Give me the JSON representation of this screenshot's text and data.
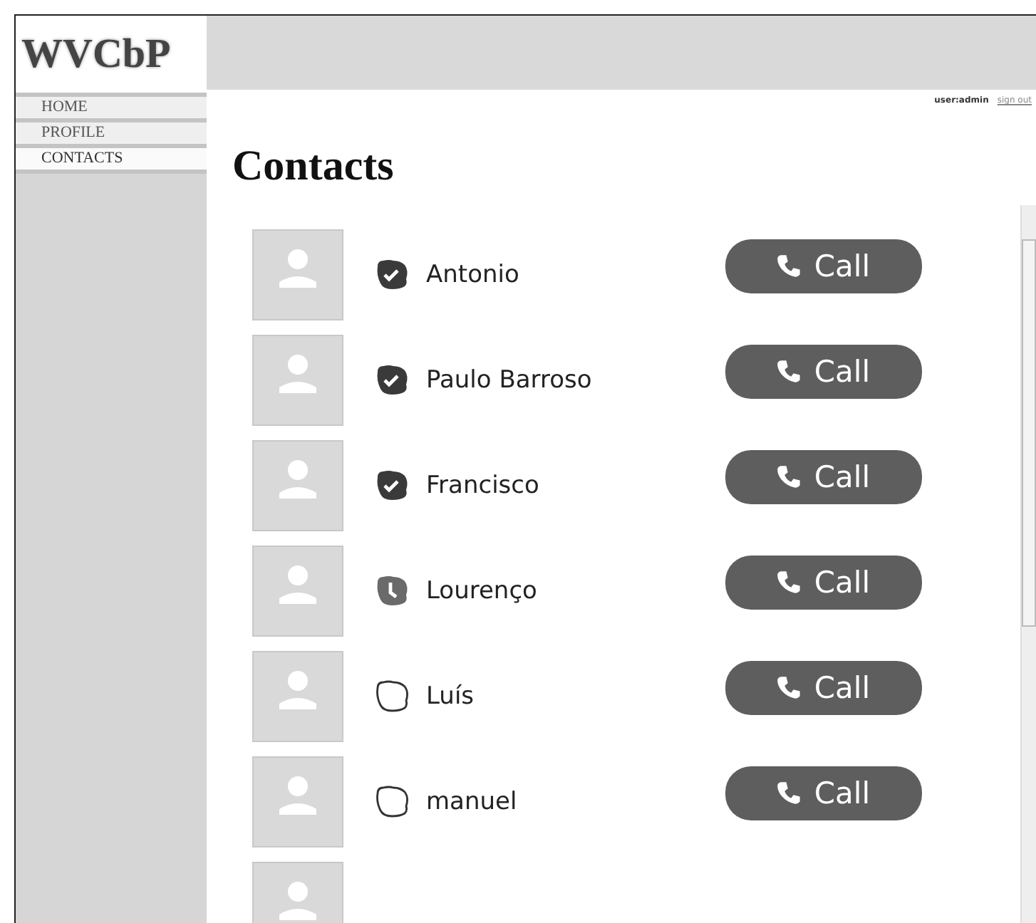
{
  "logo": "WVCbP",
  "nav": [
    {
      "label": "HOME",
      "selected": false
    },
    {
      "label": "PROFILE",
      "selected": false
    },
    {
      "label": "CONTACTS",
      "selected": true
    }
  ],
  "user": {
    "name": "user:admin",
    "sign_out": "sign out"
  },
  "title": "Contacts",
  "contacts": [
    {
      "name": "Antonio",
      "kind": "online",
      "call": "Call"
    },
    {
      "name": "Paulo Barroso",
      "kind": "online",
      "call": "Call"
    },
    {
      "name": "Francisco",
      "kind": "online",
      "call": "Call"
    },
    {
      "name": "Lourenço",
      "kind": "away",
      "call": "Call"
    },
    {
      "name": "Luís",
      "kind": "offline",
      "call": "Call"
    },
    {
      "name": "manuel",
      "kind": "offline",
      "call": "Call"
    }
  ]
}
